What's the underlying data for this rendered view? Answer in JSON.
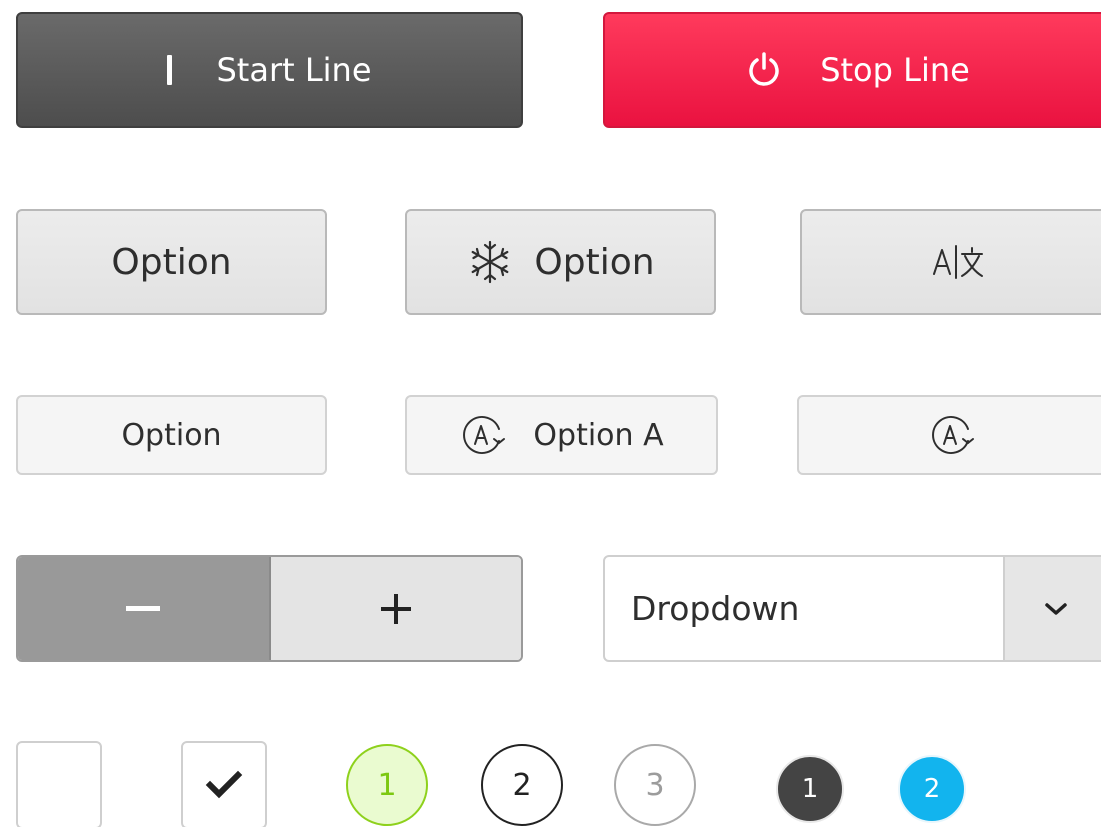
{
  "line_controls": {
    "start_label": "Start Line",
    "stop_label": "Stop Line",
    "start_icon": "cursor-bar-icon",
    "stop_icon": "power-icon"
  },
  "large_options": [
    {
      "label": "Option",
      "icon": null
    },
    {
      "label": "Option",
      "icon": "snowflake-icon"
    },
    {
      "label": "",
      "icon": "translate-icon"
    }
  ],
  "medium_options": [
    {
      "label": "Option",
      "icon": null
    },
    {
      "label": "Option A",
      "icon": "auto-mode-icon"
    },
    {
      "label": "",
      "icon": "auto-mode-icon"
    }
  ],
  "stepper": {
    "minus": "minus",
    "plus": "plus"
  },
  "dropdown": {
    "value": "Dropdown"
  },
  "checkboxes": [
    {
      "checked": false
    },
    {
      "checked": true
    }
  ],
  "steps": [
    {
      "label": "1",
      "state": "active"
    },
    {
      "label": "2",
      "state": "default"
    },
    {
      "label": "3",
      "state": "disabled"
    }
  ],
  "small_steps": [
    {
      "label": "1",
      "state": "completed"
    },
    {
      "label": "2",
      "state": "current"
    }
  ],
  "colors": {
    "stop_red": "#f0184a",
    "active_green": "#8ed11c",
    "current_blue": "#12b4ee",
    "dark_gray": "#555555"
  }
}
